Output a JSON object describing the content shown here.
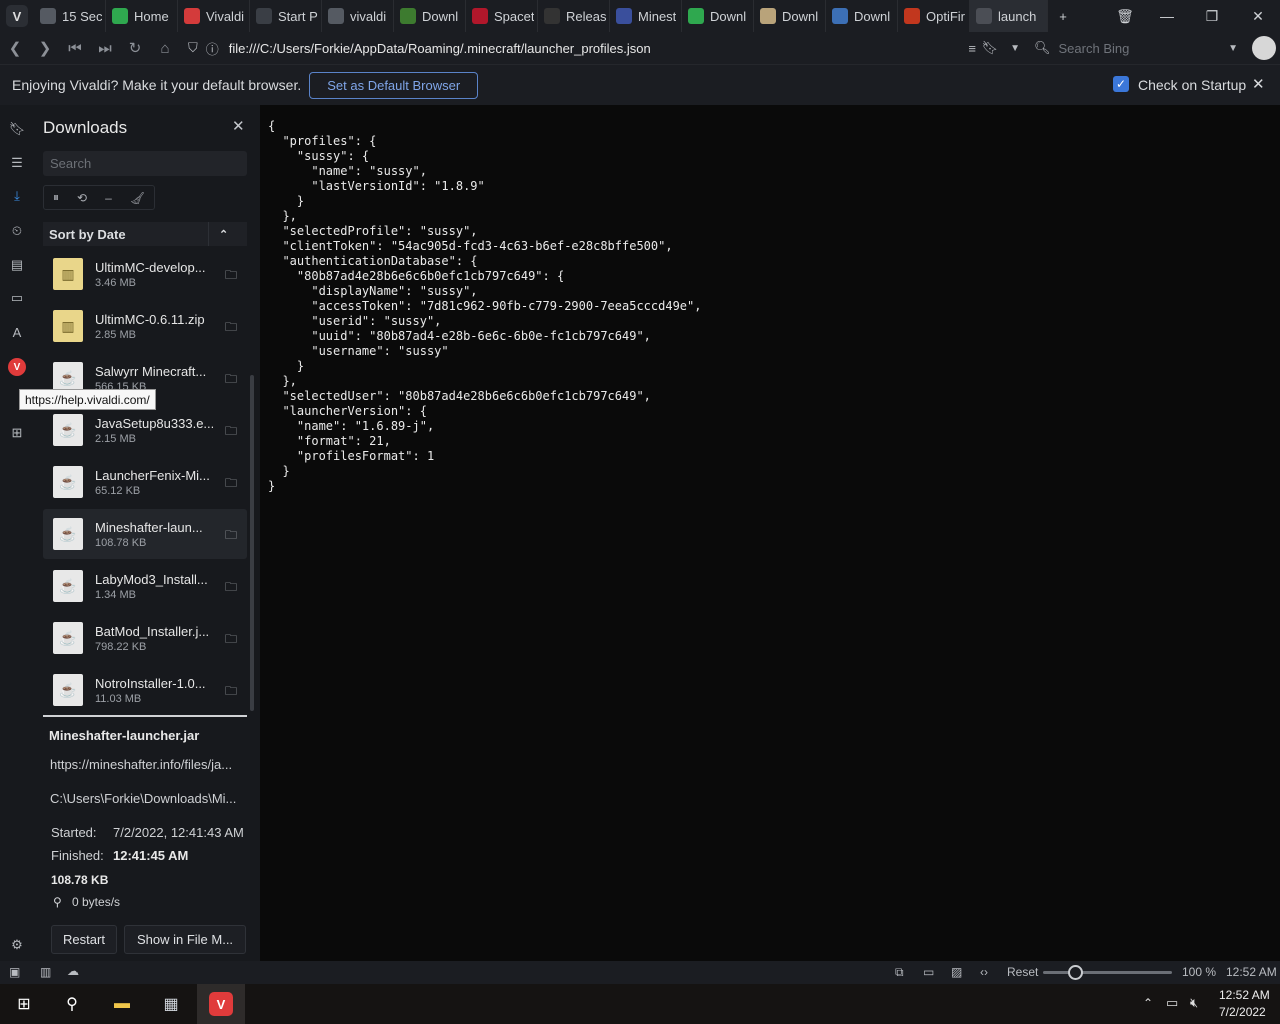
{
  "tabs": [
    {
      "label": "15 Sec",
      "icon": "globe-icon",
      "color": "#555a62"
    },
    {
      "label": "Home",
      "icon": "green-h-icon",
      "color": "#2fa84f"
    },
    {
      "label": "Vivaldi",
      "icon": "vivaldi-red-icon",
      "color": "#d43b3b"
    },
    {
      "label": "Start P",
      "icon": "grid-icon",
      "color": "#3a3e45"
    },
    {
      "label": "vivaldi",
      "icon": "globe-icon",
      "color": "#555a62"
    },
    {
      "label": "Downl",
      "icon": "curseforge-icon",
      "color": "#3d7b2f"
    },
    {
      "label": "Spacet",
      "icon": "red-arrow-icon",
      "color": "#b1172b"
    },
    {
      "label": "Releas",
      "icon": "github-icon",
      "color": "#333"
    },
    {
      "label": "Minest",
      "icon": "minestuck-icon",
      "color": "#3a4f9c"
    },
    {
      "label": "Downl",
      "icon": "creeper-icon",
      "color": "#2fa84f"
    },
    {
      "label": "Downl",
      "icon": "document-icon",
      "color": "#b9a37a"
    },
    {
      "label": "Downl",
      "icon": "fabric-icon",
      "color": "#3c6fb5"
    },
    {
      "label": "OptiFir",
      "icon": "optifine-icon",
      "color": "#c2371e"
    },
    {
      "label": "launch",
      "icon": "page-icon",
      "color": "#4b4e55",
      "active": true
    }
  ],
  "address": {
    "url": "file:///C:/Users/Forkie/AppData/Roaming/.minecraft/launcher_profiles.json",
    "search_placeholder": "Search Bing"
  },
  "notification": {
    "text": "Enjoying Vivaldi? Make it your default browser.",
    "button": "Set as Default Browser",
    "checkbox_label": "Check on Startup",
    "checked": true
  },
  "panel": {
    "title": "Downloads",
    "search_placeholder": "Search",
    "sort_label": "Sort by Date",
    "items": [
      {
        "name": "UltimMC-develop...",
        "size": "3.46 MB",
        "type": "zip"
      },
      {
        "name": "UltimMC-0.6.11.zip",
        "size": "2.85 MB",
        "type": "zip"
      },
      {
        "name": "Salwyrr Minecraft...",
        "size": "566.15 KB",
        "type": "jar"
      },
      {
        "name": "JavaSetup8u333.e...",
        "size": "2.15 MB",
        "type": "jar"
      },
      {
        "name": "LauncherFenix-Mi...",
        "size": "65.12 KB",
        "type": "jar"
      },
      {
        "name": "Mineshafter-laun...",
        "size": "108.78 KB",
        "type": "jar",
        "selected": true
      },
      {
        "name": "LabyMod3_Install...",
        "size": "1.34 MB",
        "type": "jar"
      },
      {
        "name": "BatMod_Installer.j...",
        "size": "798.22 KB",
        "type": "jar"
      },
      {
        "name": "NotroInstaller-1.0...",
        "size": "11.03 MB",
        "type": "jar"
      }
    ],
    "details": {
      "filename": "Mineshafter-launcher.jar",
      "url": "https://mineshafter.info/files/ja...",
      "path": "C:\\Users\\Forkie\\Downloads\\Mi...",
      "started_label": "Started:",
      "started": "7/2/2022, 12:41:43 AM",
      "finished_label": "Finished:",
      "finished": "12:41:45 AM",
      "size": "108.78 KB",
      "speed": "0 bytes/s",
      "restart": "Restart",
      "show": "Show in File M..."
    }
  },
  "tooltip": "https://help.vivaldi.com/",
  "json_text": "{\n  \"profiles\": {\n    \"sussy\": {\n      \"name\": \"sussy\",\n      \"lastVersionId\": \"1.8.9\"\n    }\n  },\n  \"selectedProfile\": \"sussy\",\n  \"clientToken\": \"54ac905d-fcd3-4c63-b6ef-e28c8bffe500\",\n  \"authenticationDatabase\": {\n    \"80b87ad4e28b6e6c6b0efc1cb797c649\": {\n      \"displayName\": \"sussy\",\n      \"accessToken\": \"7d81c962-90fb-c779-2900-7eea5cccd49e\",\n      \"userid\": \"sussy\",\n      \"uuid\": \"80b87ad4-e28b-6e6c-6b0e-fc1cb797c649\",\n      \"username\": \"sussy\"\n    }\n  },\n  \"selectedUser\": \"80b87ad4e28b6e6c6b0efc1cb797c649\",\n  \"launcherVersion\": {\n    \"name\": \"1.6.89-j\",\n    \"format\": 21,\n    \"profilesFormat\": 1\n  }\n}",
  "status": {
    "reset": "Reset",
    "zoom": "100 %",
    "time": "12:52 AM",
    "zoom_level": 0.25
  },
  "taskbar": {
    "time": "12:52 AM",
    "date": "7/2/2022"
  }
}
